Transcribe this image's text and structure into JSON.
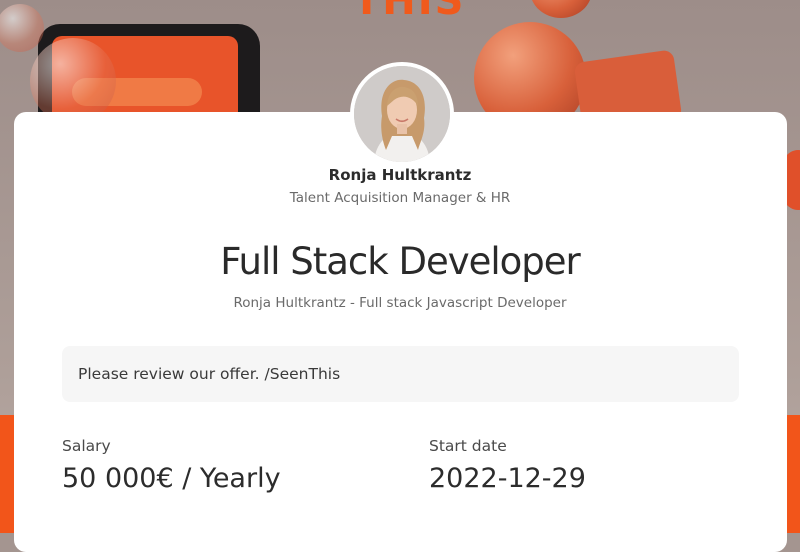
{
  "hero": {
    "headline_fragment": "THIS"
  },
  "recruiter": {
    "name": "Ronja Hultkrantz",
    "role": "Talent Acquisition Manager & HR"
  },
  "offer": {
    "title": "Full Stack Developer",
    "subtitle": "Ronja Hultkrantz - Full stack Javascript Developer",
    "message": "Please review our offer. /SeenThis"
  },
  "details": {
    "salary_label": "Salary",
    "salary_value": "50 000€ / Yearly",
    "start_label": "Start date",
    "start_value": "2022-12-29"
  },
  "colors": {
    "accent": "#f2551a",
    "card": "#ffffff",
    "message_bg": "#f6f6f6"
  }
}
